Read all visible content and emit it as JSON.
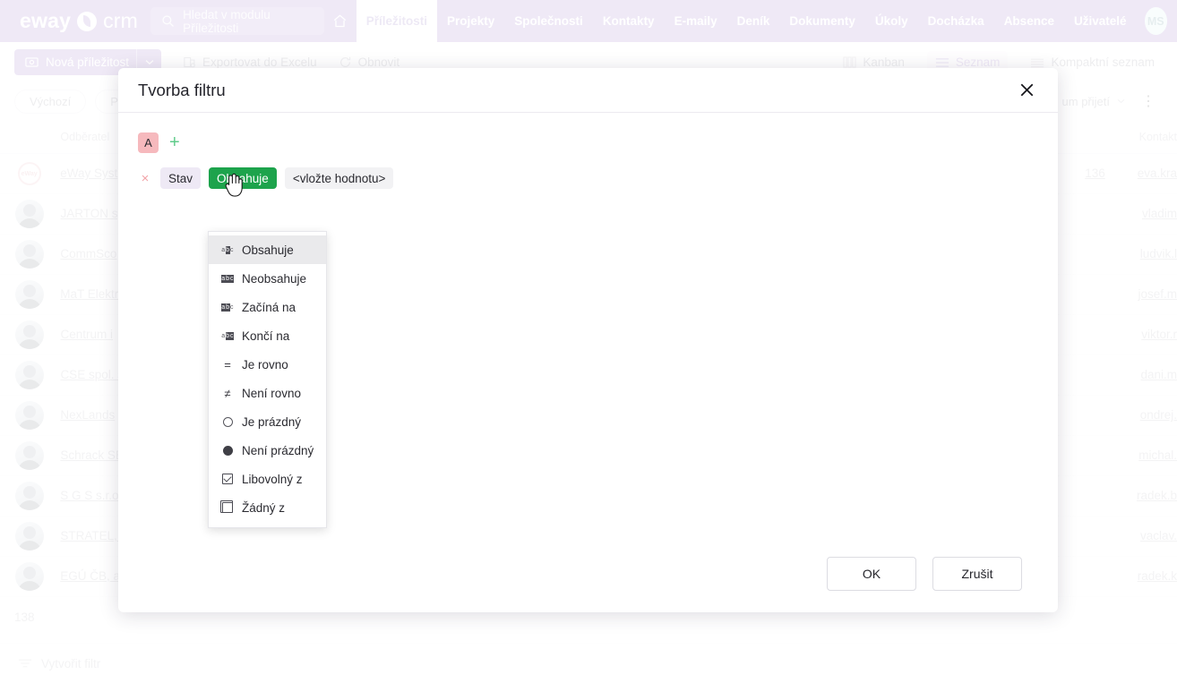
{
  "topbar": {
    "brand_main": "eway",
    "brand_sub": "crm",
    "brand_mark_icon": "eway-logo-icon",
    "search_placeholder": "Hledat v modulu Příležitosti",
    "search_icon": "search-icon",
    "home_icon": "home-icon",
    "nav": [
      {
        "label": "Příležitosti",
        "active": true
      },
      {
        "label": "Projekty",
        "active": false
      },
      {
        "label": "Společnosti",
        "active": false
      },
      {
        "label": "Kontakty",
        "active": false
      },
      {
        "label": "E-maily",
        "active": false
      },
      {
        "label": "Deník",
        "active": false
      },
      {
        "label": "Dokumenty",
        "active": false
      },
      {
        "label": "Úkoly",
        "active": false
      },
      {
        "label": "Docházka",
        "active": false
      },
      {
        "label": "Absence",
        "active": false
      },
      {
        "label": "Uživatelé",
        "active": false
      }
    ],
    "avatar_initials": "MS",
    "bg_color": "#7a4fb5"
  },
  "toolbar": {
    "new_label": "Nová příležitost",
    "new_icon": "opportunity-icon",
    "caret_icon": "chevron-down-icon",
    "export_label": "Exportovat do Excelu",
    "export_icon": "excel-export-icon",
    "refresh_label": "Obnovit",
    "refresh_icon": "refresh-icon",
    "kanban_label": "Kanban",
    "kanban_icon": "kanban-icon",
    "list_label": "Seznam",
    "list_icon": "list-icon",
    "compact_label": "Kompaktní seznam",
    "compact_icon": "compact-list-icon"
  },
  "chips": {
    "items": [
      {
        "label": "Výchozí"
      },
      {
        "label": "Příle"
      }
    ],
    "sort_label": "um přijetí",
    "sort_caret_icon": "chevron-down-icon",
    "kebab_icon": "more-vertical-icon"
  },
  "table": {
    "headers": {
      "customer": "Odběratel",
      "contact": "Kontakt"
    },
    "rows": [
      {
        "name": "eWay Syst",
        "number": "136",
        "contact": "eva.kra",
        "avatar": "logo"
      },
      {
        "name": "JARTON sp",
        "number": "",
        "contact": "vladim",
        "avatar": "person"
      },
      {
        "name": "CommSco",
        "number": "",
        "contact": "ludvik.l",
        "avatar": "person"
      },
      {
        "name": "MaT Elektr",
        "number": "",
        "contact": "josef.m",
        "avatar": "person"
      },
      {
        "name": "Centrum i",
        "number": "",
        "contact": "viktor.r",
        "avatar": "person"
      },
      {
        "name": "CSE spol. s",
        "number": "",
        "contact": "dani.m",
        "avatar": "person"
      },
      {
        "name": "NexLands",
        "number": "",
        "contact": "ondrej.",
        "avatar": "person"
      },
      {
        "name": "Schrack SE",
        "number": "",
        "contact": "michal.",
        "avatar": "person"
      },
      {
        "name": "S G S s.r.o.",
        "number": "",
        "contact": "radek.b",
        "avatar": "person"
      },
      {
        "name": "STRATEL, s",
        "number": "",
        "contact": "vaclav.",
        "avatar": "person"
      },
      {
        "name": "EGÚ ČB, a.",
        "number": "",
        "contact": "radek.k",
        "avatar": "person"
      }
    ],
    "row_count": "138",
    "create_filter_label": "Vytvořit filtr",
    "create_filter_icon": "filter-icon"
  },
  "modal": {
    "title": "Tvorba filtru",
    "close_icon": "close-icon",
    "group": {
      "badge": "A",
      "add_icon": "plus-icon",
      "add_label": "+"
    },
    "condition": {
      "delete_icon": "close-icon",
      "delete_label": "×",
      "field": "Stav",
      "operator": "Obsahuje",
      "value": "<vložte hodnotu>"
    },
    "operator_menu": {
      "items": [
        {
          "label": "Obsahuje",
          "icon": "abc-contains-icon",
          "highlighted": true
        },
        {
          "label": "Neobsahuje",
          "icon": "abc-not-contains-icon",
          "highlighted": false
        },
        {
          "label": "Začíná na",
          "icon": "abc-starts-with-icon",
          "highlighted": false
        },
        {
          "label": "Končí na",
          "icon": "abc-ends-with-icon",
          "highlighted": false
        },
        {
          "label": "Je rovno",
          "icon": "equals-icon",
          "highlighted": false
        },
        {
          "label": "Není rovno",
          "icon": "not-equals-icon",
          "highlighted": false
        },
        {
          "label": "Je prázdný",
          "icon": "empty-circle-icon",
          "highlighted": false
        },
        {
          "label": "Není prázdný",
          "icon": "filled-circle-icon",
          "highlighted": false
        },
        {
          "label": "Libovolný z",
          "icon": "checked-box-icon",
          "highlighted": false
        },
        {
          "label": "Žádný z",
          "icon": "double-box-icon",
          "highlighted": false
        }
      ],
      "glyphs": {
        "equals": "=",
        "not_equals": "≠"
      }
    },
    "buttons": {
      "ok": "OK",
      "cancel": "Zrušit"
    }
  },
  "colors": {
    "brand_purple": "#7a4fb5",
    "operator_green": "#1da34c",
    "group_badge_pink": "#f6b9bd",
    "plus_green": "#5fcb8a",
    "delete_red": "#f2a3a8"
  },
  "cursor": {
    "icon": "pointing-hand-cursor"
  }
}
